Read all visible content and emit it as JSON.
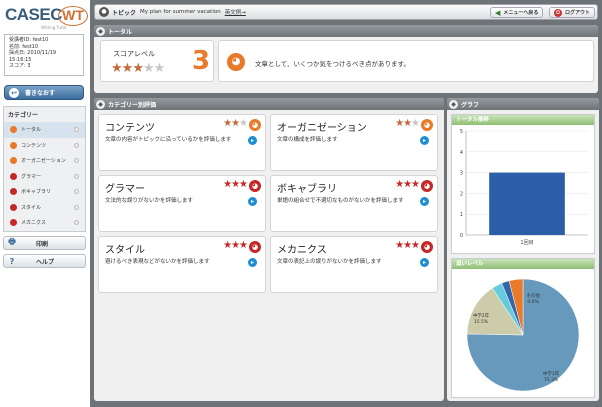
{
  "logo": {
    "main": "CASEC",
    "badge": "WT",
    "sub": "Writing Tutor"
  },
  "user": {
    "lines": [
      "受講者ID: fest10",
      "名前: fest10",
      "採点日: 2010/11/19",
      "15:16:15",
      "スコア: 3"
    ]
  },
  "sidebar": {
    "redo_label": "書きなおす",
    "category_title": "カテゴリー",
    "items": [
      {
        "label": "トータル",
        "color": "#e87a2a",
        "active": true
      },
      {
        "label": "コンテンツ",
        "color": "#e87a2a",
        "active": false
      },
      {
        "label": "オーガニゼーション",
        "color": "#e87a2a",
        "active": false
      },
      {
        "label": "グラマー",
        "color": "#c62828",
        "active": false
      },
      {
        "label": "ボキャブラリ",
        "color": "#c62828",
        "active": false
      },
      {
        "label": "スタイル",
        "color": "#c62828",
        "active": false
      },
      {
        "label": "メカニクス",
        "color": "#c62828",
        "active": false
      }
    ],
    "print_label": "印刷",
    "help_label": "ヘルプ"
  },
  "topbar": {
    "topic_label": "トピック",
    "topic_text": "My plan for summer vacation",
    "sample_link": "英文例→",
    "menu_button": "メニューへ戻る",
    "logout_button": "ログアウト"
  },
  "total": {
    "header": "トータル",
    "score_label": "スコアレベル",
    "score": "3",
    "stars_filled": 3,
    "stars_total": 5,
    "comment": "文章として、いくつか気をつけるべき点があります。"
  },
  "categories_panel": {
    "header": "カテゴリー別評価",
    "cards": [
      {
        "name": "コンテンツ",
        "stars": 2,
        "tone": "orange",
        "desc": "文章の内容がトピックに沿っているかを評価します"
      },
      {
        "name": "オーガニゼーション",
        "stars": 2,
        "tone": "orange",
        "desc": "文章の構成を評価します"
      },
      {
        "name": "グラマー",
        "stars": 3,
        "tone": "red",
        "desc": "文法的な誤りがないかを評価します"
      },
      {
        "name": "ボキャブラリ",
        "stars": 3,
        "tone": "red",
        "desc": "単語の組合せで不適切なものがないかを評価します"
      },
      {
        "name": "スタイル",
        "stars": 3,
        "tone": "red",
        "desc": "避けるべき表現などがないかを評価します"
      },
      {
        "name": "メカニクス",
        "stars": 3,
        "tone": "red",
        "desc": "文章の表記上の誤りがないかを評価します"
      }
    ]
  },
  "graph_panel": {
    "header": "グラフ",
    "trend_title": "トータル推移",
    "level_title": "追いレベル"
  },
  "chart_data": [
    {
      "type": "bar",
      "title": "トータル推移",
      "categories": [
        "1回目"
      ],
      "values": [
        3
      ],
      "ylim": [
        0,
        5
      ],
      "yticks": [
        0,
        1,
        2,
        3,
        4,
        5
      ],
      "color": "#2b5ea8"
    },
    {
      "type": "pie",
      "title": "追いレベル",
      "slices": [
        {
          "label": "中学1年",
          "value": 75.3,
          "color": "#6699bb"
        },
        {
          "label": "中学2年",
          "value": 15.5,
          "color": "#ccccaa"
        },
        {
          "label": "",
          "value": 3.0,
          "color": "#66ccdd"
        },
        {
          "label": "",
          "value": 2.2,
          "color": "#3366aa"
        },
        {
          "label": "その他",
          "value": 4.0,
          "color": "#e87a2a"
        }
      ],
      "slice_labels": [
        "中学1年\n75.3%",
        "中学2年\n15.5%",
        "その他\n4.0%"
      ]
    }
  ]
}
